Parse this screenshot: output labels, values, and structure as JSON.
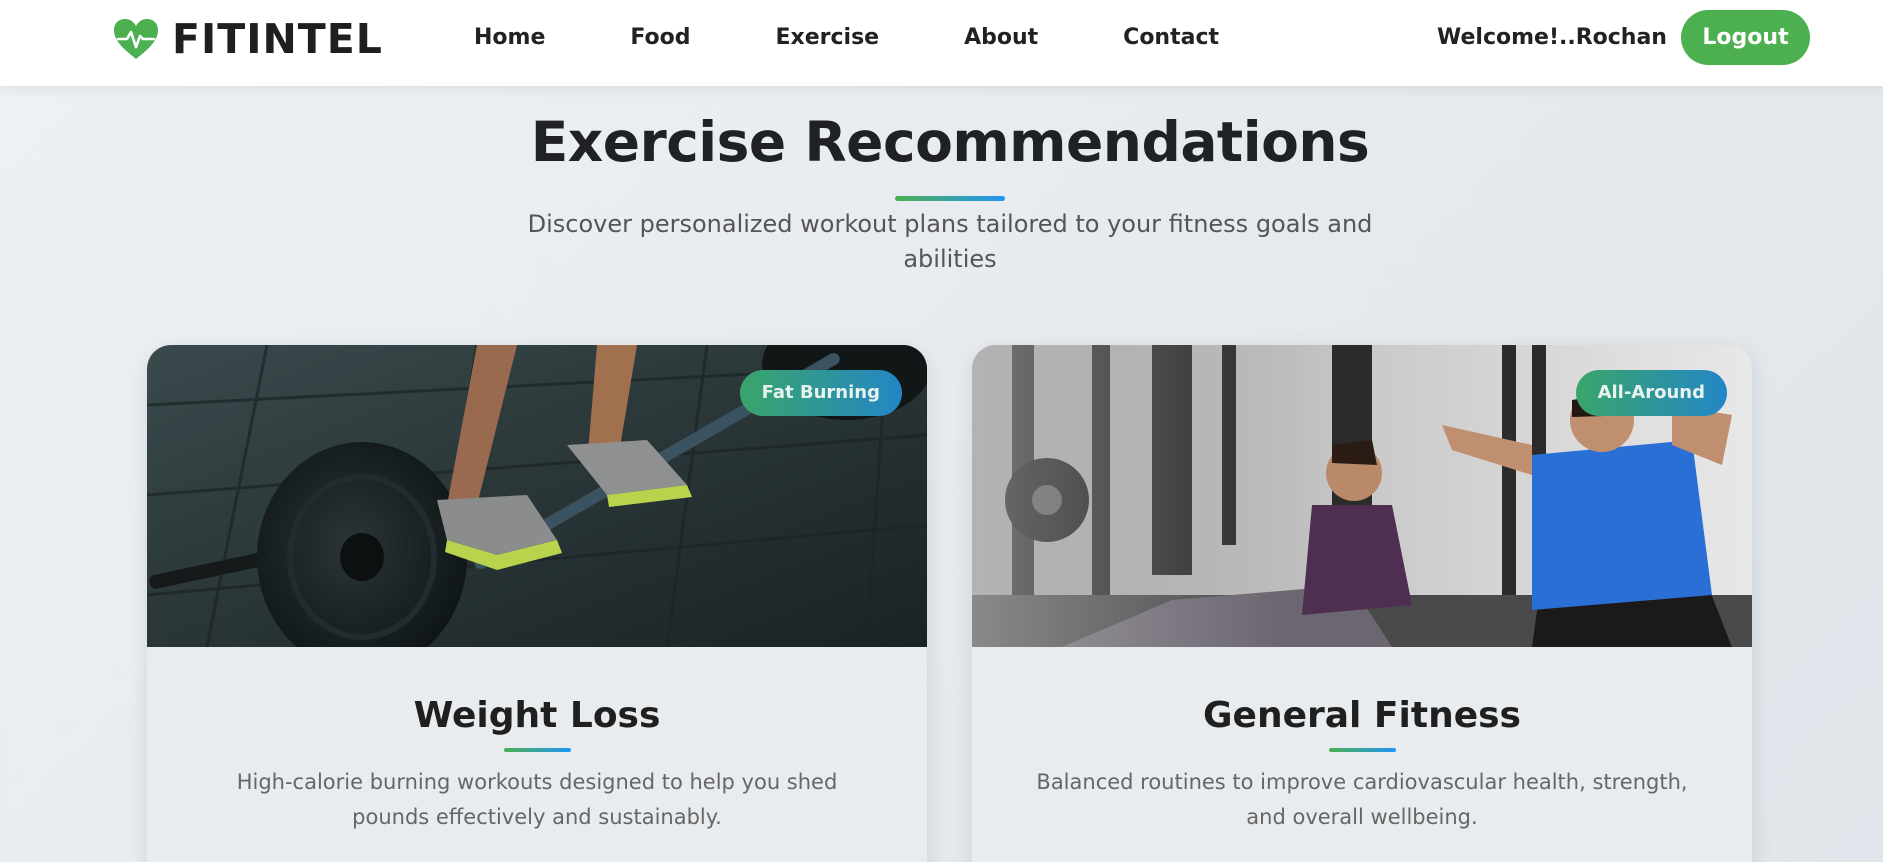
{
  "brand": {
    "name": "FITINTEL",
    "icon": "heart-pulse-icon"
  },
  "nav": {
    "links": [
      {
        "label": "Home"
      },
      {
        "label": "Food"
      },
      {
        "label": "Exercise"
      },
      {
        "label": "About"
      },
      {
        "label": "Contact"
      }
    ],
    "welcome": "Welcome!..Rochan",
    "logout_label": "Logout"
  },
  "hero": {
    "title": "Exercise Recommendations",
    "subtitle": "Discover personalized workout plans tailored to your fitness goals and abilities"
  },
  "cards": [
    {
      "title": "Weight Loss",
      "badge": "Fat Burning",
      "description": "High-calorie burning workouts designed to help you shed pounds effectively and sustainably."
    },
    {
      "title": "General Fitness",
      "badge": "All-Around",
      "description": "Balanced routines to improve cardiovascular health, strength, and overall wellbeing."
    }
  ],
  "colors": {
    "accent_green": "#4caf50",
    "accent_blue": "#2196f3"
  }
}
